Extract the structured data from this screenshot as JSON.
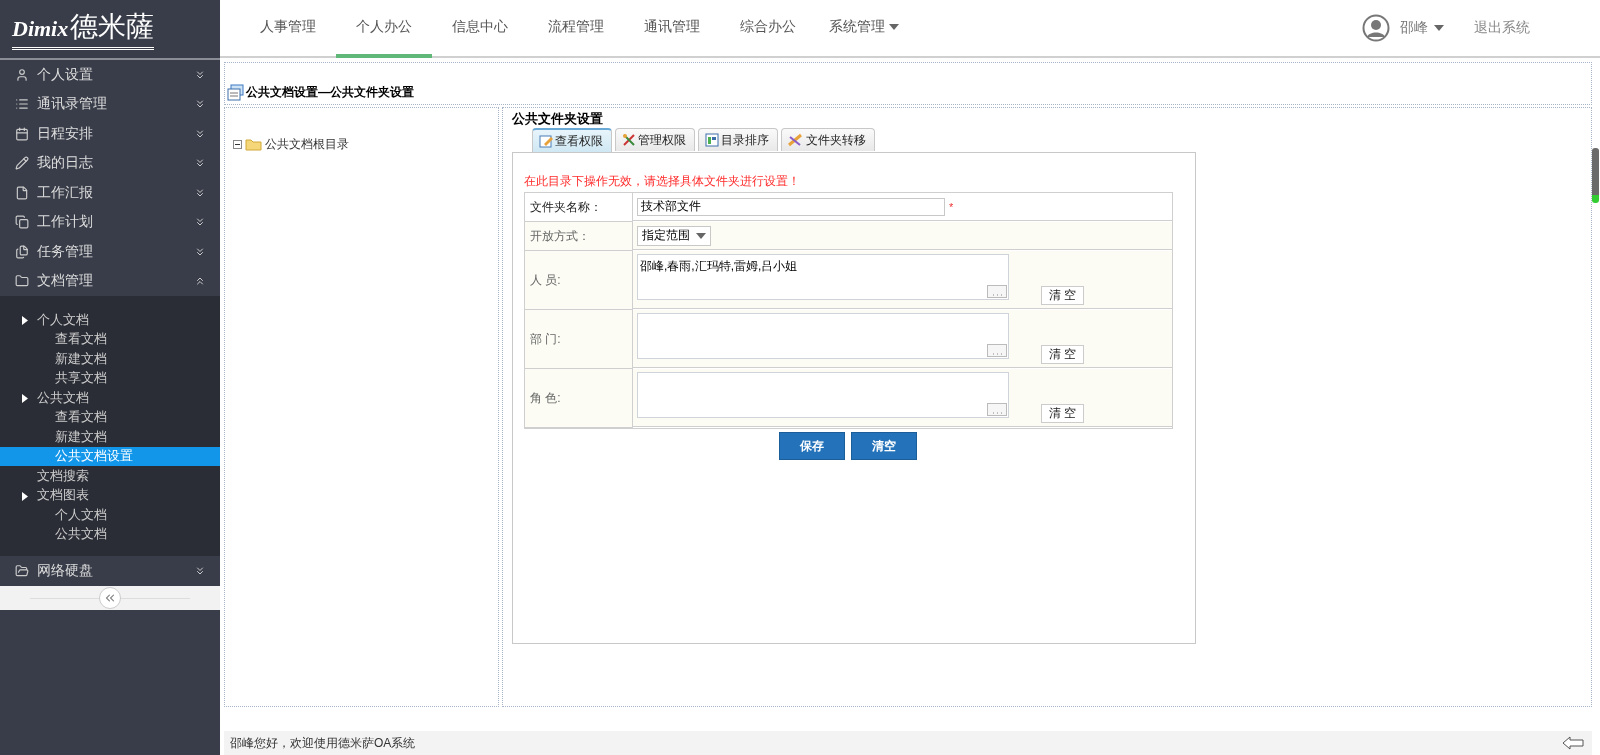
{
  "logo": {
    "latin": "Dimix",
    "cjk": "德米薩"
  },
  "nav": [
    {
      "label": "人事管理",
      "selected": false,
      "has_menu": false
    },
    {
      "label": "个人办公",
      "selected": true,
      "has_menu": false
    },
    {
      "label": "信息中心",
      "selected": false,
      "has_menu": false
    },
    {
      "label": "流程管理",
      "selected": false,
      "has_menu": false
    },
    {
      "label": "通讯管理",
      "selected": false,
      "has_menu": false
    },
    {
      "label": "综合办公",
      "selected": false,
      "has_menu": false
    },
    {
      "label": "系统管理",
      "selected": false,
      "has_menu": true
    }
  ],
  "user": {
    "name": "邵峰",
    "has_menu": true,
    "logout": "退出系统"
  },
  "sidebar": {
    "items": [
      {
        "label": "个人设置",
        "expanded": false
      },
      {
        "label": "通讯录管理",
        "expanded": false
      },
      {
        "label": "日程安排",
        "expanded": false
      },
      {
        "label": "我的日志",
        "expanded": false
      },
      {
        "label": "工作汇报",
        "expanded": false
      },
      {
        "label": "工作计划",
        "expanded": false
      },
      {
        "label": "任务管理",
        "expanded": false
      },
      {
        "label": "文档管理",
        "expanded": true,
        "children": [
          {
            "label": "个人文档",
            "selected": false,
            "children": [
              {
                "label": "查看文档",
                "selected": false
              },
              {
                "label": "新建文档",
                "selected": false
              },
              {
                "label": "共享文档",
                "selected": false
              }
            ]
          },
          {
            "label": "公共文档",
            "selected": false,
            "children": [
              {
                "label": "查看文档",
                "selected": false
              },
              {
                "label": "新建文档",
                "selected": false
              },
              {
                "label": "公共文档设置",
                "selected": true
              }
            ]
          },
          {
            "label": "文档搜索",
            "selected": false
          },
          {
            "label": "文档图表",
            "selected": false,
            "children": [
              {
                "label": "个人文档",
                "selected": false
              },
              {
                "label": "公共文档",
                "selected": false
              }
            ]
          }
        ]
      },
      {
        "label": "网络硬盘",
        "expanded": false
      }
    ]
  },
  "page_title": "公共文档设置—公共文件夹设置",
  "tree": {
    "label": "公共文档根目录",
    "expanded": true
  },
  "panel": {
    "title": "公共文件夹设置",
    "tabs": [
      {
        "label": "查看权限",
        "selected": true
      },
      {
        "label": "管理权限",
        "selected": false
      },
      {
        "label": "目录排序",
        "selected": false
      },
      {
        "label": "文件夹转移",
        "selected": false
      }
    ],
    "warning": "在此目录下操作无效，请选择具体文件夹进行设置！",
    "rows": [
      {
        "kind": "text",
        "label": "文件夹名称：",
        "value": "技术部文件",
        "required_mark": "*"
      },
      {
        "kind": "select",
        "label": "开放方式：",
        "value": "指定范围"
      },
      {
        "kind": "picker",
        "label": "人 员:",
        "value": "邵峰,春雨,汇玛特,雷姆,吕小姐",
        "button": "清 空"
      },
      {
        "kind": "picker",
        "label": "部 门:",
        "button": "清 空"
      },
      {
        "kind": "picker",
        "label": "角 色:",
        "button": "清 空"
      }
    ],
    "buttons": [
      "保存",
      "清空"
    ]
  },
  "status_bar": "邵峰您好，欢迎使用德米萨OA系统"
}
